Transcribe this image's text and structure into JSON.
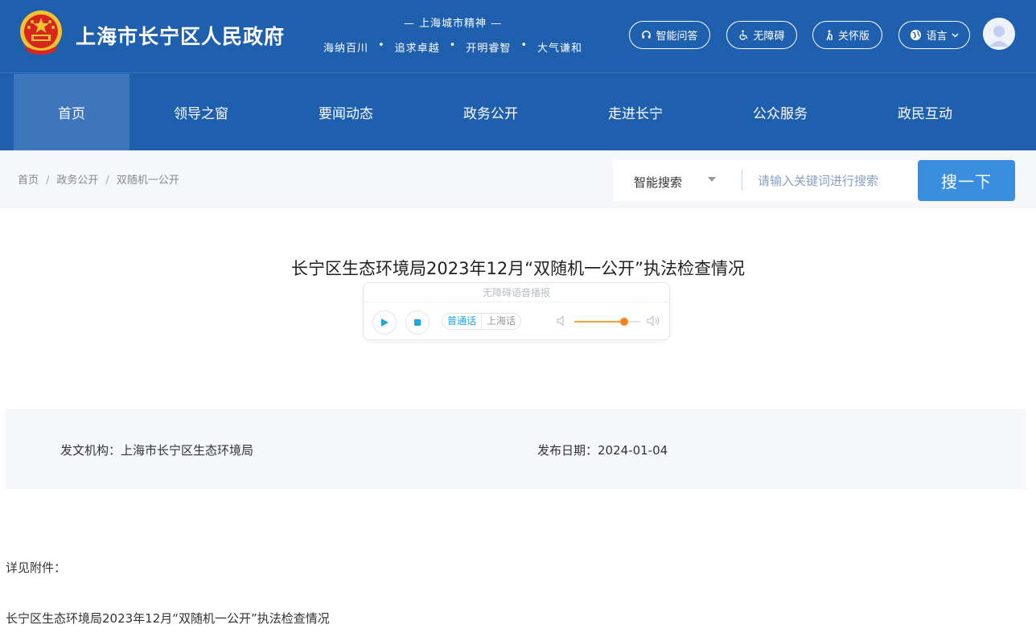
{
  "header": {
    "site_title": "上海市长宁区人民政府",
    "spirit_title": "— 上海城市精神 —",
    "spirit_words": [
      "海纳百川",
      "追求卓越",
      "开明睿智",
      "大气谦和"
    ],
    "buttons": {
      "qa": "智能问答",
      "accessibility": "无障碍",
      "care": "关怀版",
      "language": "语言"
    },
    "colors": {
      "primary": "#1e5fae",
      "nav_active": "#3d76ba"
    }
  },
  "nav": {
    "items": [
      "首页",
      "领导之窗",
      "要闻动态",
      "政务公开",
      "走进长宁",
      "公众服务",
      "政民互动"
    ],
    "active_index": 0
  },
  "breadcrumb": [
    "首页",
    "政务公开",
    "双随机一公开"
  ],
  "search": {
    "type_label": "智能搜索",
    "placeholder": "请输入关键词进行搜索",
    "button_label": "搜一下",
    "button_color": "#3a8ee0"
  },
  "article": {
    "title": "长宁区生态环境局2023年12月“双随机一公开”执法检查情况",
    "player": {
      "header": "无障碍语音播报",
      "lang_mandarin": "普通话",
      "lang_shanghai": "上海话",
      "volume": 0.75
    },
    "meta": {
      "org": "发文机构：上海市长宁区生态环境局",
      "date": "发布日期：2024-01-04"
    },
    "body": [
      "详见附件：",
      "长宁区生态环境局2023年12月“双随机一公开”执法检查情况"
    ]
  }
}
